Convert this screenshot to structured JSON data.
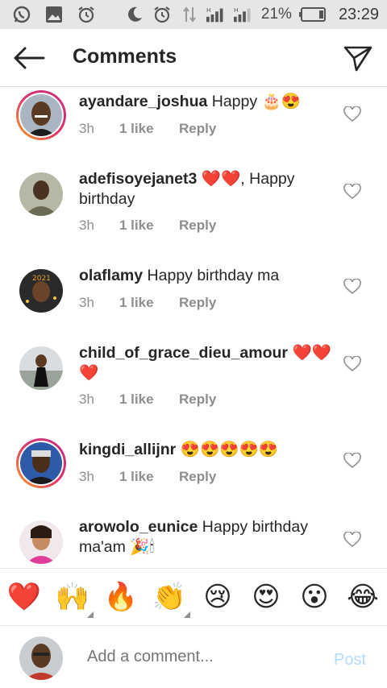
{
  "status_bar": {
    "battery_percent": "21%",
    "time": "23:29",
    "icons": [
      "whatsapp-icon",
      "gallery-icon",
      "alarm-icon",
      "moon-icon",
      "alarm-icon",
      "data-arrows-icon",
      "signal-h-icon",
      "signal-h-icon",
      "battery-icon"
    ]
  },
  "header": {
    "title": "Comments",
    "back_icon": "arrow-left-icon",
    "send_icon": "paper-plane-icon"
  },
  "comments": [
    {
      "user": "ayandare_joshua",
      "text": "Happy 🎂😍",
      "time": "3h",
      "likes": "1 like",
      "reply": "Reply",
      "story_ring": true
    },
    {
      "user": "adefisoyejanet3",
      "text": "❤️❤️, Happy birthday",
      "time": "3h",
      "likes": "1 like",
      "reply": "Reply",
      "story_ring": false
    },
    {
      "user": "olaflamy",
      "text": "Happy birthday ma",
      "time": "3h",
      "likes": "1 like",
      "reply": "Reply",
      "story_ring": false
    },
    {
      "user": "child_of_grace_dieu_amour",
      "text": "❤️❤️❤️",
      "time": "3h",
      "likes": "1 like",
      "reply": "Reply",
      "story_ring": false
    },
    {
      "user": "kingdi_allijnr",
      "text": "😍😍😍😍😍",
      "time": "3h",
      "likes": "1 like",
      "reply": "Reply",
      "story_ring": true
    },
    {
      "user": "arowolo_eunice",
      "text": "Happy birthday ma'am 🎉🕯",
      "time": "",
      "likes": "",
      "reply": "",
      "story_ring": false
    }
  ],
  "emoji_bar": [
    "❤️",
    "🙌",
    "🔥",
    "👏",
    "😢",
    "😍",
    "😮",
    "😂"
  ],
  "composer": {
    "placeholder": "Add a comment...",
    "post_label": "Post"
  },
  "colors": {
    "status_bar_bg": "#e6e6e6",
    "text": "#262626",
    "meta": "#8e8e8e",
    "post_disabled": "#b3dbff"
  }
}
